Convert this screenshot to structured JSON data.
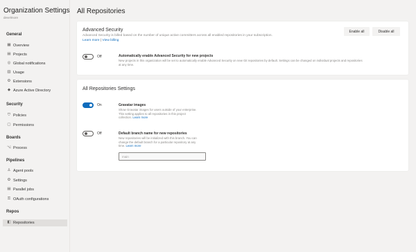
{
  "sidebar": {
    "title": "Organization Settings",
    "subtitle": "develmore",
    "sections": [
      {
        "heading": "General",
        "items": [
          {
            "label": "Overview",
            "icon": "overview-icon"
          },
          {
            "label": "Projects",
            "icon": "projects-icon"
          },
          {
            "label": "Global notifications",
            "icon": "notifications-icon"
          },
          {
            "label": "Usage",
            "icon": "usage-icon"
          },
          {
            "label": "Extensions",
            "icon": "extensions-icon"
          },
          {
            "label": "Azure Active Directory",
            "icon": "azure-ad-icon"
          }
        ]
      },
      {
        "heading": "Security",
        "items": [
          {
            "label": "Policies",
            "icon": "policies-icon"
          },
          {
            "label": "Permissions",
            "icon": "permissions-icon"
          }
        ]
      },
      {
        "heading": "Boards",
        "items": [
          {
            "label": "Process",
            "icon": "process-icon"
          }
        ]
      },
      {
        "heading": "Pipelines",
        "items": [
          {
            "label": "Agent pools",
            "icon": "agent-pools-icon"
          },
          {
            "label": "Settings",
            "icon": "settings-icon"
          },
          {
            "label": "Parallel jobs",
            "icon": "parallel-jobs-icon"
          },
          {
            "label": "OAuth configurations",
            "icon": "oauth-icon"
          }
        ]
      },
      {
        "heading": "Repos",
        "items": [
          {
            "label": "Repositories",
            "icon": "repositories-icon",
            "active": true
          }
        ]
      }
    ]
  },
  "main": {
    "title": "All Repositories",
    "advanced_security": {
      "title": "Advanced Security",
      "description": "Advanced Security is billed based on the number of unique active committers across all enabled repositories in your subscription.",
      "learn_more": "Learn more",
      "separator": "|",
      "view_billing": "View billing",
      "enable_all": "Enable all",
      "disable_all": "Disable all",
      "toggle_state": "Off",
      "auto_enable_title": "Automatically enable Advanced Security for new projects",
      "auto_enable_desc_lines": [
        "New projects in this organization will be set to automatically enable Advanced Security on new Git repositories by default. Settings can be changed on individual projects and repositories",
        "at any time."
      ]
    },
    "all_repos_settings": {
      "title": "All Repositories Settings",
      "gravatar": {
        "toggle_state": "On",
        "title": "Gravatar images",
        "desc_lines": [
          "Show Gravatar images for users outside of your enterprise.",
          "This setting applies to all repositories in this project",
          "collection."
        ],
        "learn_more": "Learn more"
      },
      "default_branch": {
        "toggle_state": "Off",
        "title": "Default branch name for new repositories",
        "desc_lines": [
          "New repositories will be initialized with this branch. You can",
          "change the default branch for a particular repository at any",
          "time."
        ],
        "learn_more": "Learn more",
        "input_placeholder": "main"
      }
    }
  },
  "colors": {
    "accent": "#0f6cbd",
    "page_background": "#f3f2f1",
    "card_background": "#ffffff",
    "active_nav": "#e1dfdd"
  }
}
